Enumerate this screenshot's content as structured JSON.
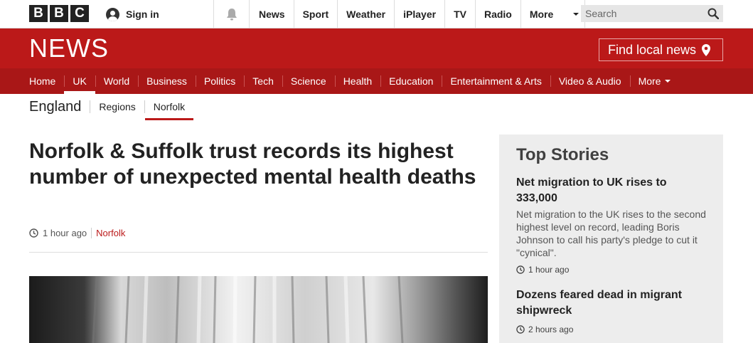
{
  "topbar": {
    "logo_letters": [
      "B",
      "B",
      "C"
    ],
    "sign_in": "Sign in",
    "nav": [
      "News",
      "Sport",
      "Weather",
      "iPlayer",
      "TV",
      "Radio"
    ],
    "more": "More",
    "search_placeholder": "Search"
  },
  "news_header": {
    "logo": "NEWS",
    "find_local": "Find local news"
  },
  "subnav": {
    "items": [
      "Home",
      "UK",
      "World",
      "Business",
      "Politics",
      "Tech",
      "Science",
      "Health",
      "Education",
      "Entertainment & Arts",
      "Video & Audio",
      "More"
    ],
    "active": "UK"
  },
  "section_nav": {
    "title": "England",
    "links": [
      "Regions",
      "Norfolk"
    ],
    "active": "Norfolk"
  },
  "article": {
    "headline": "Norfolk & Suffolk trust records its highest number of unexpected mental health deaths",
    "time": "1 hour ago",
    "tag": "Norfolk"
  },
  "sidebar": {
    "title": "Top Stories",
    "stories": [
      {
        "title": "Net migration to UK rises to 333,000",
        "summary": "Net migration to the UK rises to the second highest level on record, leading Boris Johnson to call his party's pledge to cut it \"cynical\".",
        "time": "1 hour ago"
      },
      {
        "title": "Dozens feared dead in migrant shipwreck",
        "summary": "",
        "time": "2 hours ago"
      }
    ]
  },
  "colors": {
    "brand_red": "#bb1919",
    "subnav_red": "#a91717",
    "sidebar_bg": "#ededed"
  }
}
